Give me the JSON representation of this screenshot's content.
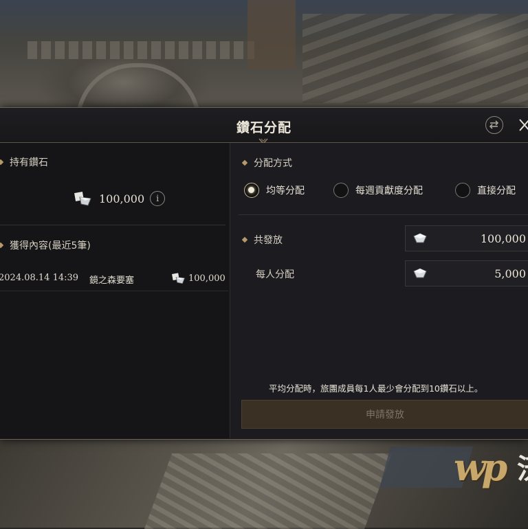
{
  "dialog": {
    "title": "鑽石分配"
  },
  "holdings": {
    "label": "持有鑽石",
    "amount": "100,000",
    "info_icon": "i"
  },
  "history": {
    "label": "獲得內容(最近5筆)",
    "records": [
      {
        "date": "2024.08.14 14:39",
        "place": "鏡之森要塞",
        "amount": "100,000"
      }
    ]
  },
  "distribution": {
    "method_label": "分配方式",
    "options": [
      {
        "label": "均等分配",
        "selected": true
      },
      {
        "label": "每週貢獻度分配",
        "selected": false
      },
      {
        "label": "直接分配",
        "selected": false
      }
    ],
    "total_label": "共發放",
    "total_value": "100,000",
    "per_person_label": "每人分配",
    "per_person_value": "5,000",
    "notice": "平均分配時，旅團成員每1人最少會分配到10鑽石以上。",
    "apply_label": "申請發放"
  },
  "icons": {
    "gem": "diamond-gem-icon",
    "close": "close-icon",
    "swap": "swap-icon",
    "info": "info-icon"
  },
  "colors": {
    "accent_gold": "#b69a6a",
    "panel_bg": "#161619",
    "button_disabled_bg": "#3a3024"
  }
}
